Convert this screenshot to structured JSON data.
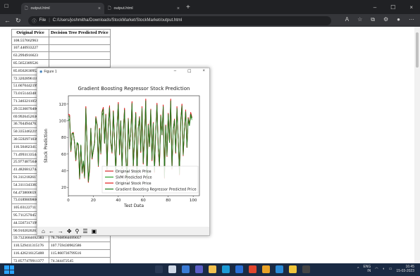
{
  "browser": {
    "tabs": [
      {
        "title": "output.html",
        "active": true
      },
      {
        "title": "output.html",
        "active": false
      }
    ],
    "url_prefix": "File",
    "url": "C:/Users/joshmitha/Downloads/StockMarket/StockMarket/output.html"
  },
  "table": {
    "headers": [
      "Original Price",
      "Decision Tree Predicted Price"
    ],
    "left_column": [
      "108.557662963",
      "107.440933227",
      "63.2994916623",
      "85.5652389526",
      "85.8562630952",
      "72.3202896118",
      "51.6070442199",
      "73.0151443481",
      "71.3463211059",
      "29.5536070406",
      "69.9926452636",
      "36.7044944763",
      "50.3353462219",
      "30.5592971038",
      "116.504623413",
      "71.4993133544",
      "25.9774875640",
      "41.4826812744",
      "91.3112182617",
      "54.3111343383",
      "64.4738006591",
      "73.0189809800",
      "105.031227111",
      "95.7112570457031",
      "44.5567317199707",
      "90.9102020263672",
      "59.7323684692383",
      "110.529411315176",
      "116.426216125488",
      "72.8577479911377"
    ],
    "right_column_visible": [
      "",
      "",
      "",
      "",
      "",
      "",
      "",
      "",
      "",
      "",
      "",
      "",
      "",
      "",
      "",
      "",
      "",
      "",
      "",
      "",
      "",
      "",
      "",
      "94.7672707607",
      "42.8278228474",
      "93.3993014565",
      "78.7608048469",
      "107.7594309025",
      "115.8607367995",
      "74.3444725427"
    ],
    "rows_right": [
      "94.7672797637586",
      "42.8278224754136",
      "93.3993014565426",
      "78.7608984699057",
      "107.759430902586",
      "115.860736799516",
      "74.344472545"
    ]
  },
  "figure": {
    "window_title": "Figure 1",
    "toolbar_icons": [
      "home-icon",
      "back-icon",
      "forward-icon",
      "pan-icon",
      "zoom-icon",
      "configure-icon",
      "save-icon"
    ]
  },
  "chart_data": {
    "type": "line",
    "title": "Gradient Boosting Regressor Stock Prediction",
    "xlabel": "Test Data",
    "ylabel": "Stock Prediction",
    "xlim": [
      0,
      105
    ],
    "ylim": [
      10,
      130
    ],
    "xticks": [
      0,
      20,
      40,
      60,
      80,
      100
    ],
    "yticks": [
      20,
      40,
      60,
      80,
      100,
      120
    ],
    "legend_position": "lower-right",
    "series": [
      {
        "name": "Original Stock Price",
        "color": "#d62728",
        "values": [
          108,
          107,
          63,
          85,
          86,
          72,
          52,
          73,
          71,
          30,
          70,
          37,
          50,
          31,
          117,
          71,
          26,
          41,
          91,
          54,
          64,
          73,
          105,
          96,
          45,
          91,
          60,
          111,
          116,
          73,
          108,
          41,
          95,
          118,
          74,
          61,
          112,
          78,
          37,
          93,
          122,
          59,
          100,
          42,
          88,
          115,
          56,
          27,
          103,
          66,
          85,
          123,
          44,
          76,
          110,
          33,
          91,
          105,
          62,
          117,
          48,
          81,
          126,
          29,
          96,
          69,
          114,
          52,
          98,
          38,
          87,
          121,
          66,
          45,
          107,
          83,
          119,
          31,
          95,
          57,
          109,
          74,
          126,
          42,
          89,
          102,
          61,
          117,
          79,
          35,
          100,
          120,
          58,
          90,
          113,
          68,
          104,
          96,
          110,
          104
        ]
      },
      {
        "name": "SVM Predicted Price",
        "color": "#2ca02c",
        "values": [
          100,
          102,
          66,
          84,
          85,
          74,
          55,
          74,
          72,
          35,
          71,
          40,
          52,
          36,
          110,
          72,
          32,
          44,
          90,
          56,
          66,
          74,
          101,
          94,
          48,
          90,
          62,
          106,
          110,
          75,
          103,
          45,
          93,
          112,
          75,
          63,
          107,
          78,
          41,
          92,
          116,
          61,
          98,
          45,
          87,
          110,
          58,
          32,
          100,
          67,
          85,
          117,
          47,
          77,
          106,
          38,
          90,
          102,
          64,
          111,
          51,
          81,
          119,
          34,
          94,
          70,
          109,
          55,
          96,
          42,
          87,
          115,
          68,
          48,
          103,
          83,
          113,
          36,
          93,
          60,
          105,
          75,
          120,
          46,
          88,
          99,
          63,
          111,
          79,
          40,
          98,
          115,
          61,
          89,
          108,
          70,
          101,
          94,
          106,
          101
        ]
      },
      {
        "name": "Original Stock Price",
        "color": "#e31a1c",
        "values": [
          108,
          107,
          63,
          85,
          86,
          72,
          52,
          73,
          71,
          30,
          70,
          37,
          50,
          31,
          117,
          71,
          26,
          41,
          91,
          54,
          64,
          73,
          105,
          96,
          45,
          91,
          60,
          111,
          116,
          73,
          108,
          41,
          95,
          118,
          74,
          61,
          112,
          78,
          37,
          93,
          122,
          59,
          100,
          42,
          88,
          115,
          56,
          27,
          103,
          66,
          85,
          123,
          44,
          76,
          110,
          33,
          91,
          105,
          62,
          117,
          48,
          81,
          126,
          29,
          96,
          69,
          114,
          52,
          98,
          38,
          87,
          121,
          66,
          45,
          107,
          83,
          119,
          31,
          95,
          57,
          109,
          74,
          126,
          42,
          89,
          102,
          61,
          117,
          79,
          35,
          100,
          120,
          58,
          90,
          113,
          68,
          104,
          96,
          110,
          104
        ]
      },
      {
        "name": "Gradient Boosting Regressor Predicted Price",
        "color": "#1f7a1f",
        "values": [
          106,
          105,
          64,
          85,
          85,
          73,
          53,
          73,
          71,
          31,
          70,
          38,
          51,
          32,
          115,
          71,
          27,
          42,
          91,
          55,
          64,
          73,
          104,
          95,
          46,
          90,
          61,
          110,
          114,
          73,
          107,
          42,
          94,
          116,
          74,
          62,
          111,
          78,
          38,
          93,
          120,
          60,
          100,
          43,
          88,
          113,
          57,
          28,
          102,
          66,
          85,
          121,
          45,
          76,
          109,
          34,
          91,
          104,
          63,
          115,
          49,
          81,
          124,
          30,
          95,
          69,
          113,
          53,
          97,
          39,
          87,
          119,
          67,
          46,
          106,
          83,
          117,
          32,
          94,
          58,
          108,
          74,
          124,
          43,
          89,
          101,
          62,
          115,
          79,
          36,
          100,
          118,
          59,
          90,
          111,
          68,
          103,
          95,
          108,
          103
        ]
      }
    ]
  },
  "taskbar": {
    "lang": "ENG",
    "region": "IN",
    "time": "16:45",
    "date": "15-03-2023"
  }
}
